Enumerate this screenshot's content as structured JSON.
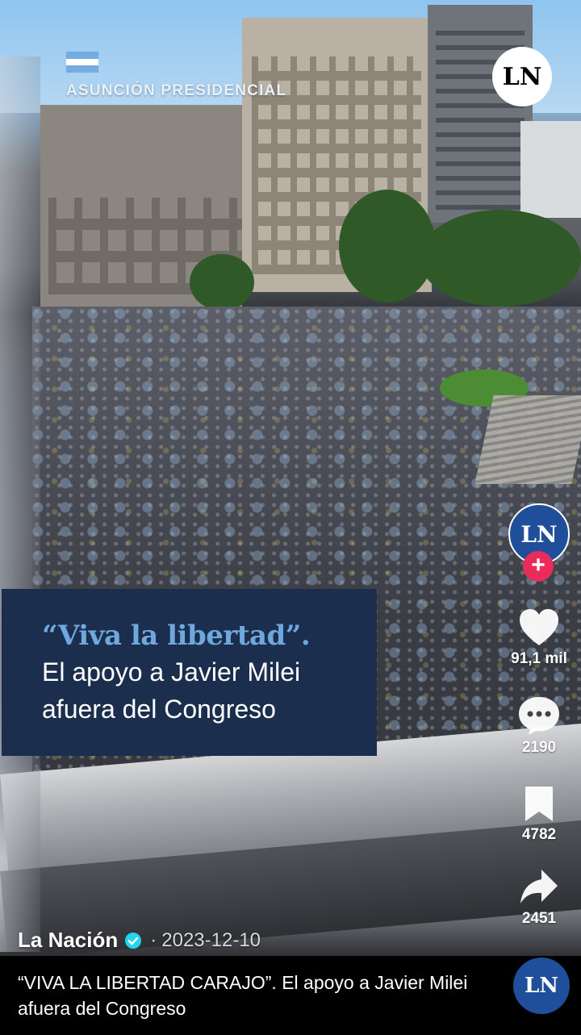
{
  "video_overlay": {
    "brand_label": "ASUNCIÓN PRESIDENCIAL",
    "logo_text": "LN",
    "caption": {
      "quote": "“Viva la libertad”.",
      "line1": "El apoyo a Javier Milei",
      "line2": "afuera del Congreso"
    },
    "flag_colors": [
      "#74acdf",
      "#ffffff",
      "#74acdf"
    ]
  },
  "actions": {
    "avatar_text": "LN",
    "follow_symbol": "+",
    "likes": "91,1 mil",
    "comments": "2190",
    "saves": "4782",
    "shares": "2451"
  },
  "post": {
    "author": "La Nación",
    "separator": "·",
    "date": "2023-12-10",
    "description": "“VIVA LA LIBERTAD CARAJO”.  El apoyo a Javier Milei afuera del Congreso",
    "bottom_avatar_text": "LN"
  },
  "colors": {
    "caption_bg": "#1c2e4d",
    "quote_color": "#6fa8dc",
    "follow_badge": "#ea2c5a",
    "verified": "#20d5ec",
    "avatar_bg": "#1f4f9a"
  },
  "icons": [
    "heart-icon",
    "comment-icon",
    "bookmark-icon",
    "share-icon",
    "verified-icon",
    "plus-icon"
  ]
}
